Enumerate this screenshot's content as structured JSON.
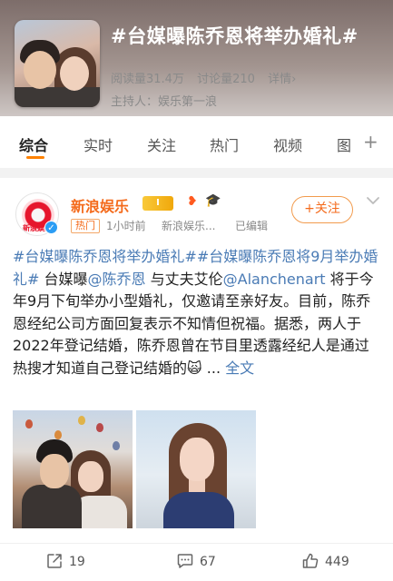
{
  "topic": {
    "title": "#台媒曝陈乔恩将举办婚礼#",
    "reads": "阅读量31.4万",
    "discussions": "讨论量210",
    "details": "详情›",
    "host": "主持人：娱乐第一浪"
  },
  "tabs": [
    {
      "label": "综合",
      "active": true
    },
    {
      "label": "实时"
    },
    {
      "label": "关注"
    },
    {
      "label": "热门"
    },
    {
      "label": "视频"
    },
    {
      "label": "图"
    }
  ],
  "tabs_more": "+",
  "post": {
    "author": "新浪娱乐",
    "avatar_text": "新浪娱乐",
    "level_badge": "I",
    "tag": "热门",
    "time": "1小时前",
    "source": "新浪娱乐...",
    "edited": "已编辑",
    "follow_label": "+关注",
    "text_segments": [
      {
        "text": "#台媒曝陈乔恩将举办婚礼##台媒曝陈乔恩将9月举办婚礼#",
        "link": true
      },
      {
        "text": " 台媒曝",
        "link": false
      },
      {
        "text": "@陈乔恩",
        "link": true
      },
      {
        "text": " 与丈夫艾伦",
        "link": false
      },
      {
        "text": "@Alanchenart",
        "link": true
      },
      {
        "text": " 将于今年9月下旬举办小型婚礼，仅邀请至亲好友。目前，陈乔恩经纪公司方面回复表示不知情但祝福。据悉，两人于2022年登记结婚，陈乔恩曾在节目里透露经纪人是通过热搜才知道自己登记结婚的🙀 ... ",
        "link": false
      },
      {
        "text": "全文",
        "link": true
      }
    ],
    "reposts": "19",
    "comments": "67",
    "likes": "449"
  },
  "colors": {
    "accent": "#ff8200",
    "author": "#f46a1b",
    "link": "#4a7bb5"
  }
}
